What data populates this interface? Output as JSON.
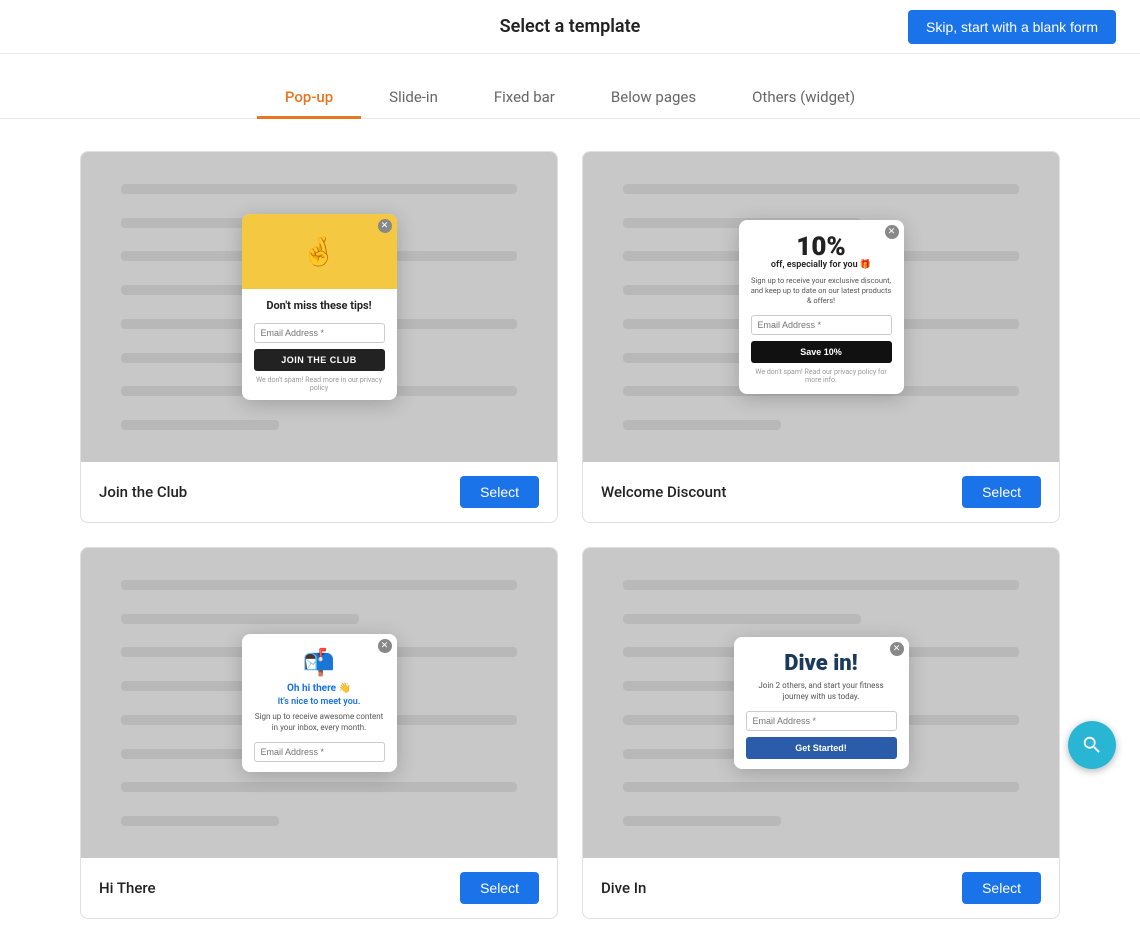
{
  "header": {
    "title": "Select a template",
    "skip_label": "Skip, start with a blank form"
  },
  "tabs": [
    {
      "id": "popup",
      "label": "Pop-up",
      "active": true
    },
    {
      "id": "slide-in",
      "label": "Slide-in",
      "active": false
    },
    {
      "id": "fixed-bar",
      "label": "Fixed bar",
      "active": false
    },
    {
      "id": "below-pages",
      "label": "Below pages",
      "active": false
    },
    {
      "id": "others",
      "label": "Others (widget)",
      "active": false
    }
  ],
  "templates": [
    {
      "id": "join-club",
      "name": "Join the Club",
      "popup": {
        "header_emoji": "🤞",
        "title": "Don't miss these tips!",
        "input_placeholder": "Email Address *",
        "cta": "JOIN THE CLUB",
        "footnote": "We don't spam! Read more in our privacy policy"
      }
    },
    {
      "id": "welcome-discount",
      "name": "Welcome Discount",
      "popup": {
        "discount_pct": "10%",
        "discount_off": "off, especially for you 🎁",
        "description": "Sign up to receive your exclusive discount, and keep up to date on our latest products & offers!",
        "input_placeholder": "Email Address *",
        "cta": "Save 10%",
        "footnote": "We don't spam! Read our privacy policy for more info."
      }
    },
    {
      "id": "hi-there",
      "name": "Hi There",
      "popup": {
        "icon": "📬",
        "title": "Oh hi there 👋",
        "subtitle": "It's nice to meet you.",
        "description": "Sign up to receive awesome content in your inbox, every month.",
        "input_placeholder": "Email Address *"
      }
    },
    {
      "id": "dive-in",
      "name": "Dive In",
      "popup": {
        "title": "Dive in!",
        "description": "Join 2 others, and start your fitness journey with us today.",
        "input_placeholder": "Email Address *",
        "cta": "Get Started!"
      }
    }
  ],
  "select_label": "Select",
  "help_icon": "search-icon"
}
